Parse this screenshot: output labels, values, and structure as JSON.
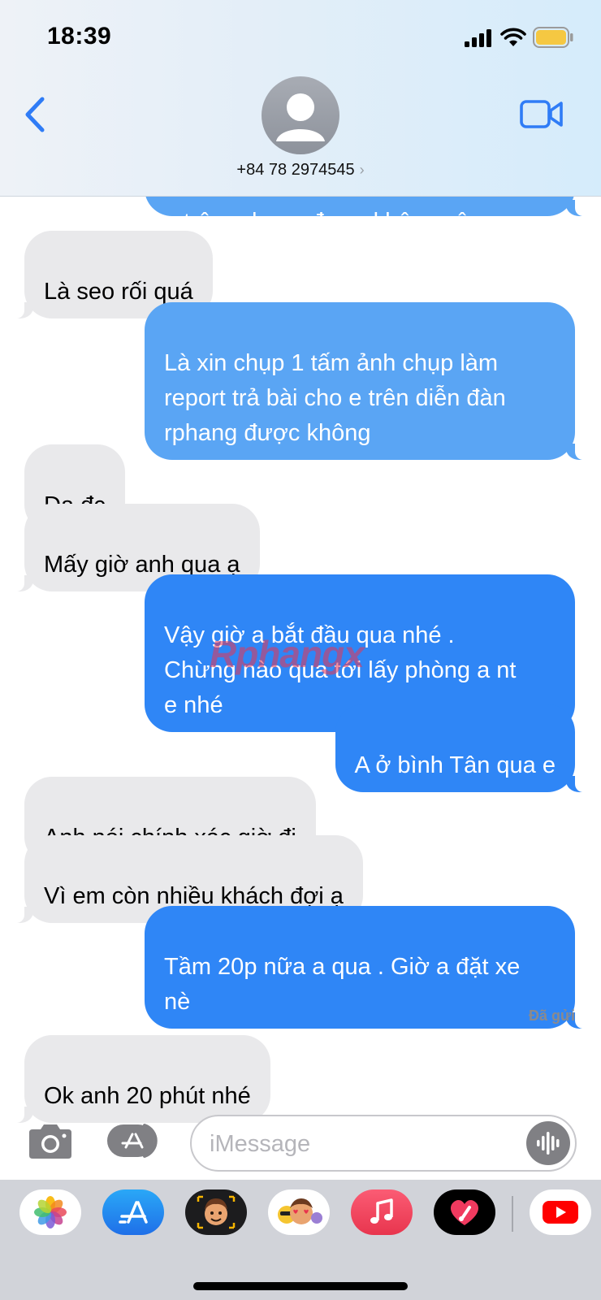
{
  "status_bar": {
    "time": "18:39"
  },
  "header": {
    "contact": "+84 78 2974545",
    "chevron": "›"
  },
  "messages": [
    {
      "dir": "sent",
      "text": "e trên rphang được không vậy"
    },
    {
      "dir": "recv",
      "text": "Là seo rối quá"
    },
    {
      "dir": "sent",
      "text": "Là xin chụp 1 tấm ảnh chụp làm\nreport trả bài cho e trên diễn đàn\nrphang được không"
    },
    {
      "dir": "recv",
      "text": "Dạ đc"
    },
    {
      "dir": "recv",
      "text": "Mấy giờ anh qua ạ"
    },
    {
      "dir": "sent",
      "text": "Vậy giờ a bắt đầu qua nhé .\nChừng nào qua tới lấy phòng a nt\ne nhé"
    },
    {
      "dir": "sent",
      "text": "A ở bình Tân qua e"
    },
    {
      "dir": "recv",
      "text": "Anh nói chính xác giờ đi"
    },
    {
      "dir": "recv",
      "text": "Vì em còn nhiều khách đợi ạ"
    },
    {
      "dir": "sent",
      "text": "Tầm 20p nữa a qua . Giờ a đặt xe\nnè"
    },
    {
      "dir": "recv",
      "text": "Ok anh 20 phút nhé"
    }
  ],
  "delivered_label": "Đã gửi",
  "watermark": "Rphangx",
  "input": {
    "placeholder": "iMessage"
  },
  "tray_apps": [
    "photos-icon",
    "app-store-icon",
    "memoji-icon",
    "animoji-stickers-icon",
    "music-icon",
    "digital-touch-icon",
    "youtube-icon"
  ],
  "colors": {
    "sent_bubble": "#2f86f6",
    "recv_bubble": "#e9e9eb",
    "accent": "#2f7cf6"
  }
}
